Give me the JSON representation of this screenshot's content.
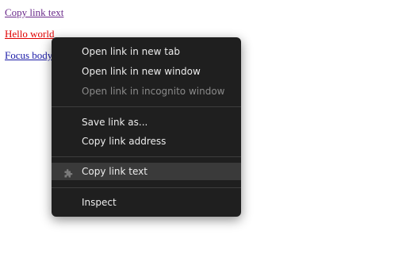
{
  "page": {
    "links": [
      {
        "text": "Copy link text",
        "color": "#6a2a8a"
      },
      {
        "text": "Hello world",
        "color": "#e00000"
      },
      {
        "text": "Focus body",
        "color": "#1a1aa6"
      }
    ]
  },
  "context_menu": {
    "colors": {
      "background": "#1f1f1f",
      "text": "#ececec",
      "disabled_text": "#8a8a8a",
      "highlight": "#3a3a3a"
    },
    "items": [
      {
        "label": "Open link in new tab",
        "enabled": true
      },
      {
        "label": "Open link in new window",
        "enabled": true
      },
      {
        "label": "Open link in incognito window",
        "enabled": false
      },
      {
        "label": "Save link as...",
        "enabled": true
      },
      {
        "label": "Copy link address",
        "enabled": true
      },
      {
        "label": "Copy link text",
        "enabled": true,
        "highlighted": true,
        "icon": "puzzle-icon"
      },
      {
        "label": "Inspect",
        "enabled": true
      }
    ]
  }
}
